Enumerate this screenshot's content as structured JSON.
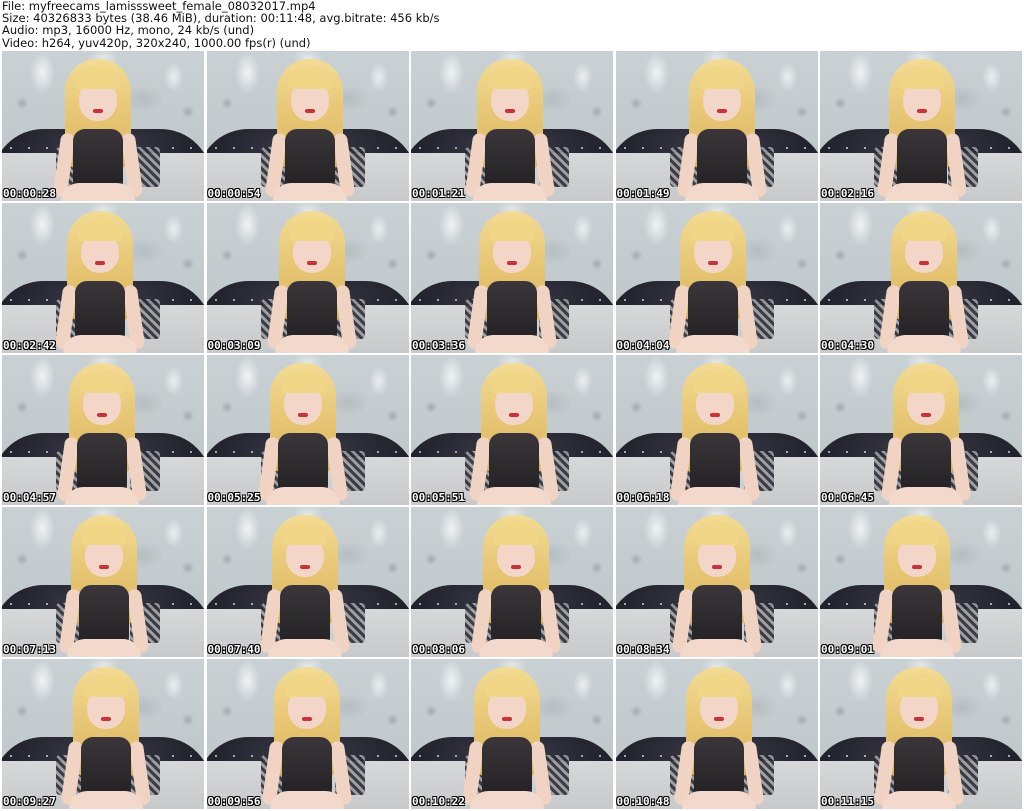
{
  "header": {
    "file_line": "File: myfreecams_lamisssweet_female_08032017.mp4",
    "size_line": "Size: 40326833 bytes (38.46 MiB), duration: 00:11:48, avg.bitrate: 456 kb/s",
    "audio_line": "Audio: mp3, 16000 Hz, mono, 24 kb/s (und)",
    "video_line": "Video: h264, yuv420p, 320x240, 1000.00 fps(r) (und)"
  },
  "thumbnails": [
    {
      "time": "00:00:28"
    },
    {
      "time": "00:00:54"
    },
    {
      "time": "00:01:21"
    },
    {
      "time": "00:01:49"
    },
    {
      "time": "00:02:16"
    },
    {
      "time": "00:02:42"
    },
    {
      "time": "00:03:09"
    },
    {
      "time": "00:03:36"
    },
    {
      "time": "00:04:04"
    },
    {
      "time": "00:04:30"
    },
    {
      "time": "00:04:57"
    },
    {
      "time": "00:05:25"
    },
    {
      "time": "00:05:51"
    },
    {
      "time": "00:06:18"
    },
    {
      "time": "00:06:45"
    },
    {
      "time": "00:07:13"
    },
    {
      "time": "00:07:40"
    },
    {
      "time": "00:08:06"
    },
    {
      "time": "00:08:34"
    },
    {
      "time": "00:09:01"
    },
    {
      "time": "00:09:27"
    },
    {
      "time": "00:09:56"
    },
    {
      "time": "00:10:22"
    },
    {
      "time": "00:10:48"
    },
    {
      "time": "00:11:15"
    }
  ],
  "colors": {
    "background": "#ffffff",
    "timestamp_text": "#ffffff",
    "timestamp_outline": "#000000"
  }
}
